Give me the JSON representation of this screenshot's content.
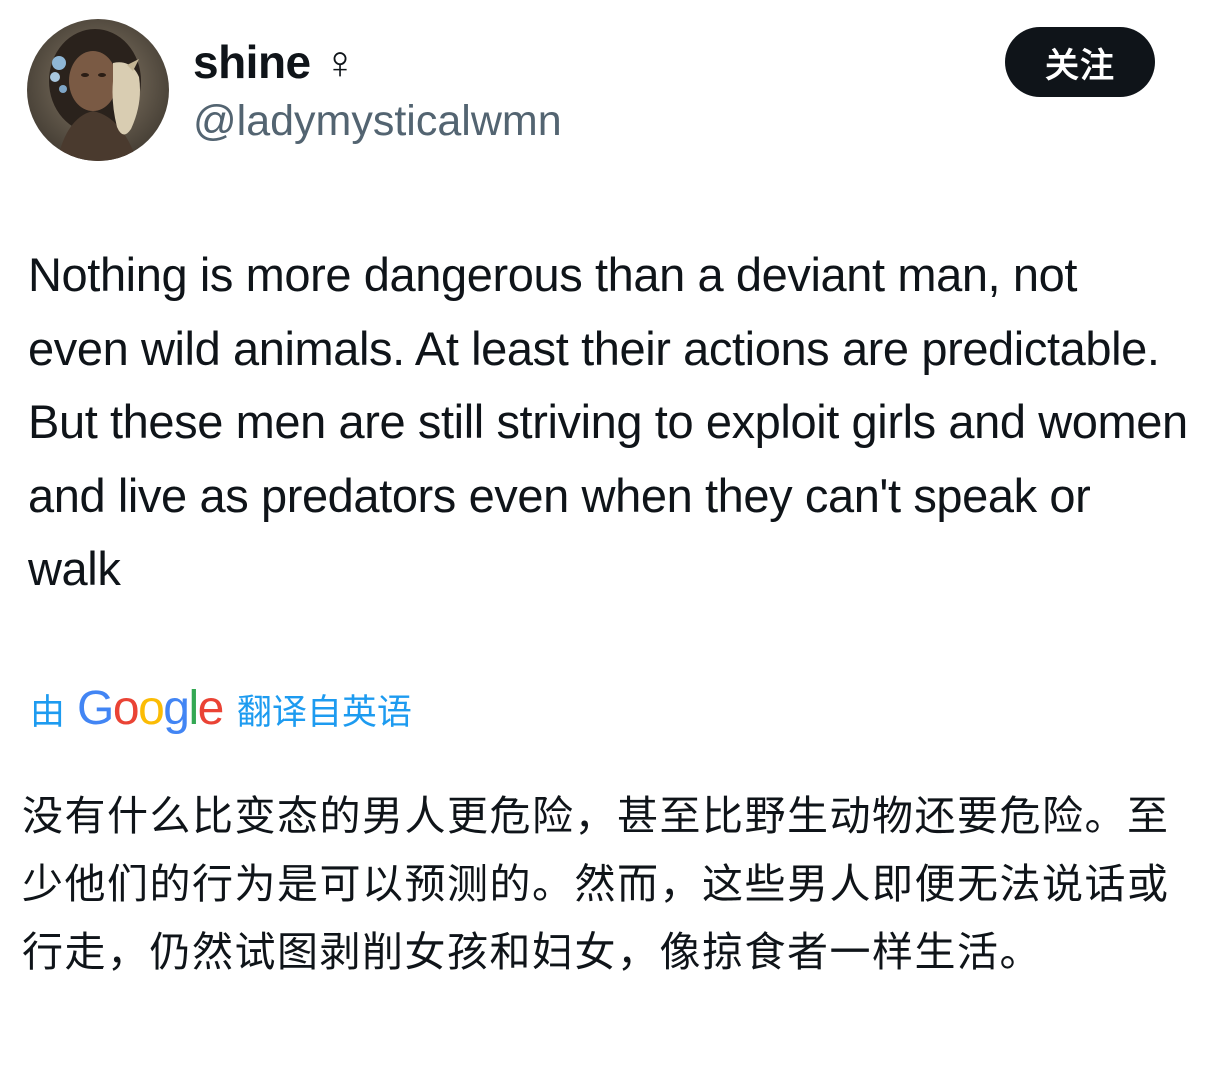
{
  "author": {
    "display_name": "shine ♀",
    "handle": "@ladymysticalwmn",
    "avatar_icon": "profile-photo"
  },
  "actions": {
    "follow_label": "关注"
  },
  "tweet": {
    "text": "Nothing is more dangerous than a deviant man, not even wild animals. At least their actions are predictable. But these men are still striving to exploit girls and women and live as predators even when they can't speak or walk"
  },
  "translation": {
    "prefix": "由",
    "provider": "Google",
    "suffix": "翻译自英语",
    "text": "没有什么比变态的男人更危险，甚至比野生动物还要危险。至少他们的行为是可以预测的。然而，这些男人即便无法说话或行走，仍然试图剥削女孩和妇女，像掠食者一样生活。"
  },
  "colors": {
    "text_primary": "#0f1419",
    "text_secondary": "#536471",
    "link": "#1d9bf0",
    "follow_bg": "#0f1419",
    "google_blue": "#4285f4",
    "google_red": "#ea4335",
    "google_yellow": "#fbbc05",
    "google_green": "#34a853"
  }
}
